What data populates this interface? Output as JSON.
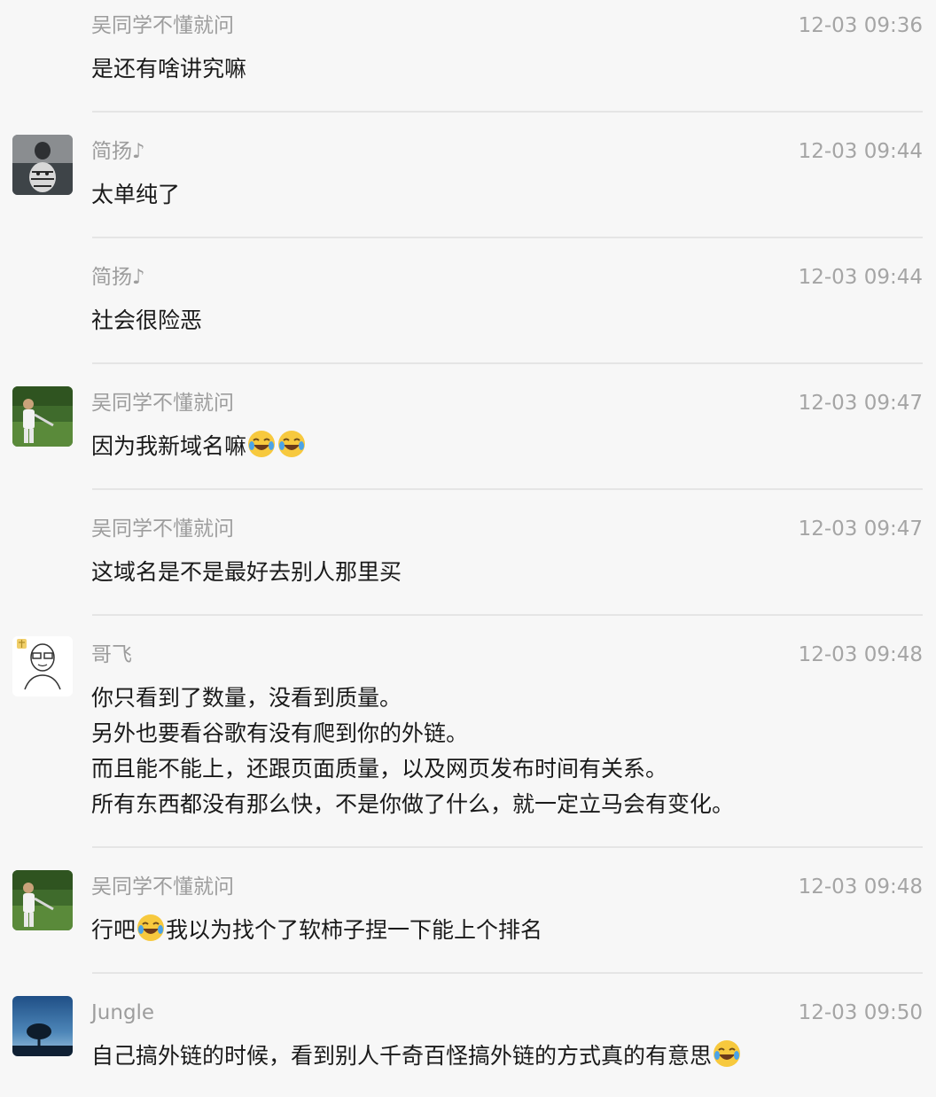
{
  "messages": [
    {
      "name": "吴同学不懂就问",
      "time": "12-03 09:36",
      "lines": [
        "是还有啥讲究嘛"
      ],
      "avatar": null
    },
    {
      "name": "简扬♪",
      "time": "12-03 09:44",
      "lines": [
        "太单纯了"
      ],
      "avatar": "tiger-reflection-avatar"
    },
    {
      "name": "简扬♪",
      "time": "12-03 09:44",
      "lines": [
        "社会很险恶"
      ],
      "avatar": null
    },
    {
      "name": "吴同学不懂就问",
      "time": "12-03 09:47",
      "lines": [
        "因为我新域名嘛"
      ],
      "emoji_after": 2,
      "avatar": "person-in-field-avatar"
    },
    {
      "name": "吴同学不懂就问",
      "time": "12-03 09:47",
      "lines": [
        "这域名是不是最好去别人那里买"
      ],
      "avatar": null
    },
    {
      "name": "哥飞",
      "time": "12-03 09:48",
      "lines": [
        "你只看到了数量，没看到质量。",
        "另外也要看谷歌有没有爬到你的外链。",
        "而且能不能上，还跟页面质量，以及网页发布时间有关系。",
        "所有东西都没有那么快，不是你做了什么，就一定立马会有变化。"
      ],
      "avatar": "cartoon-man-avatar"
    },
    {
      "name": "吴同学不懂就问",
      "time": "12-03 09:48",
      "parts": [
        "行吧",
        "我以为找个了软柿子捏一下能上个排名"
      ],
      "avatar": "person-in-field-avatar"
    },
    {
      "name": "Jungle",
      "time": "12-03 09:50",
      "lines": [
        "自己搞外链的时候，看到别人千奇百怪搞外链的方式真的有意思"
      ],
      "emoji_after": 1,
      "avatar": "tree-sky-avatar"
    }
  ],
  "emoji": "face-with-tears-of-joy-icon",
  "colors": {
    "background": "#f7f7f7",
    "name": "#9d9d9d",
    "time": "#a5a5a5",
    "text": "#1a1a1a",
    "divider": "#e5e5e5"
  }
}
